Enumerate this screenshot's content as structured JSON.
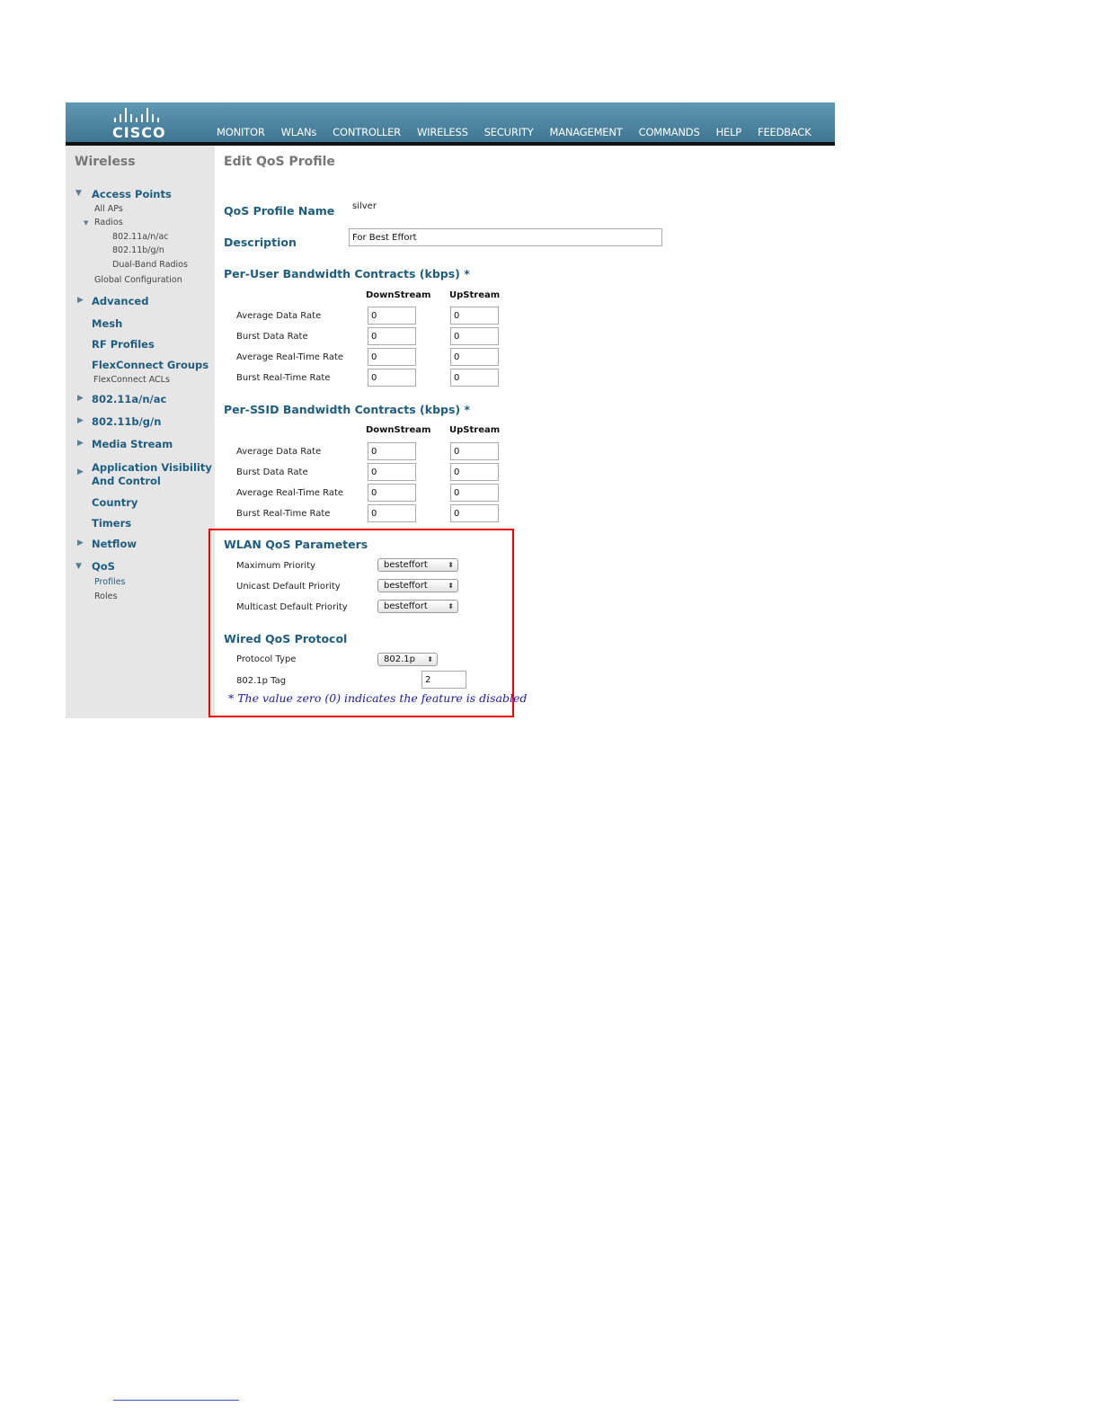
{
  "brand": {
    "logo_text": "CISCO"
  },
  "nav": {
    "items": [
      {
        "label": "MONITOR"
      },
      {
        "label": "WLANs"
      },
      {
        "label": "CONTROLLER"
      },
      {
        "label": "WIRELESS",
        "active": true
      },
      {
        "label": "SECURITY"
      },
      {
        "label": "MANAGEMENT"
      },
      {
        "label": "COMMANDS"
      },
      {
        "label": "HELP"
      },
      {
        "label": "FEEDBACK"
      }
    ],
    "active_color": "#f5a623"
  },
  "sidebar": {
    "title": "Wireless",
    "access_points": "Access Points",
    "all_aps": "All APs",
    "radios": "Radios",
    "radio_a": "802.11a/n/ac",
    "radio_b": "802.11b/g/n",
    "dual_band": "Dual-Band Radios",
    "global_config": "Global Configuration",
    "advanced": "Advanced",
    "mesh": "Mesh",
    "rf_profiles": "RF Profiles",
    "flex_groups": "FlexConnect Groups",
    "flex_acls": "FlexConnect ACLs",
    "s80211a": "802.11a/n/ac",
    "s80211b": "802.11b/g/n",
    "media_stream": "Media Stream",
    "app_vis_1": "Application Visibility",
    "app_vis_2": "And Control",
    "country": "Country",
    "timers": "Timers",
    "netflow": "Netflow",
    "qos": "QoS",
    "profiles": "Profiles",
    "roles": "Roles"
  },
  "main": {
    "title": "Edit QoS Profile",
    "profile_name_label": "QoS Profile Name",
    "profile_name_value": "silver",
    "description_label": "Description",
    "description_value": "For Best Effort",
    "per_user": {
      "title": "Per-User Bandwidth Contracts (kbps) *",
      "downstream": "DownStream",
      "upstream": "UpStream",
      "rows": [
        {
          "label": "Average Data Rate",
          "down": "0",
          "up": "0"
        },
        {
          "label": "Burst Data Rate",
          "down": "0",
          "up": "0"
        },
        {
          "label": "Average Real-Time Rate",
          "down": "0",
          "up": "0"
        },
        {
          "label": "Burst Real-Time Rate",
          "down": "0",
          "up": "0"
        }
      ]
    },
    "per_ssid": {
      "title": "Per-SSID Bandwidth Contracts (kbps) *",
      "downstream": "DownStream",
      "upstream": "UpStream",
      "rows": [
        {
          "label": "Average Data Rate",
          "down": "0",
          "up": "0"
        },
        {
          "label": "Burst Data Rate",
          "down": "0",
          "up": "0"
        },
        {
          "label": "Average Real-Time Rate",
          "down": "0",
          "up": "0"
        },
        {
          "label": "Burst Real-Time Rate",
          "down": "0",
          "up": "0"
        }
      ]
    },
    "wlan_qos": {
      "title": "WLAN QoS Parameters",
      "max_priority_label": "Maximum Priority",
      "max_priority_value": "besteffort",
      "unicast_label": "Unicast Default Priority",
      "unicast_value": "besteffort",
      "multicast_label": "Multicast Default Priority",
      "multicast_value": "besteffort"
    },
    "wired_qos": {
      "title": "Wired QoS Protocol",
      "protocol_label": "Protocol Type",
      "protocol_value": "802.1p",
      "tag_label": "802.1p Tag",
      "tag_value": "2"
    },
    "note": "* The value zero (0) indicates the feature is disabled"
  },
  "highlight_color": "#e00000"
}
